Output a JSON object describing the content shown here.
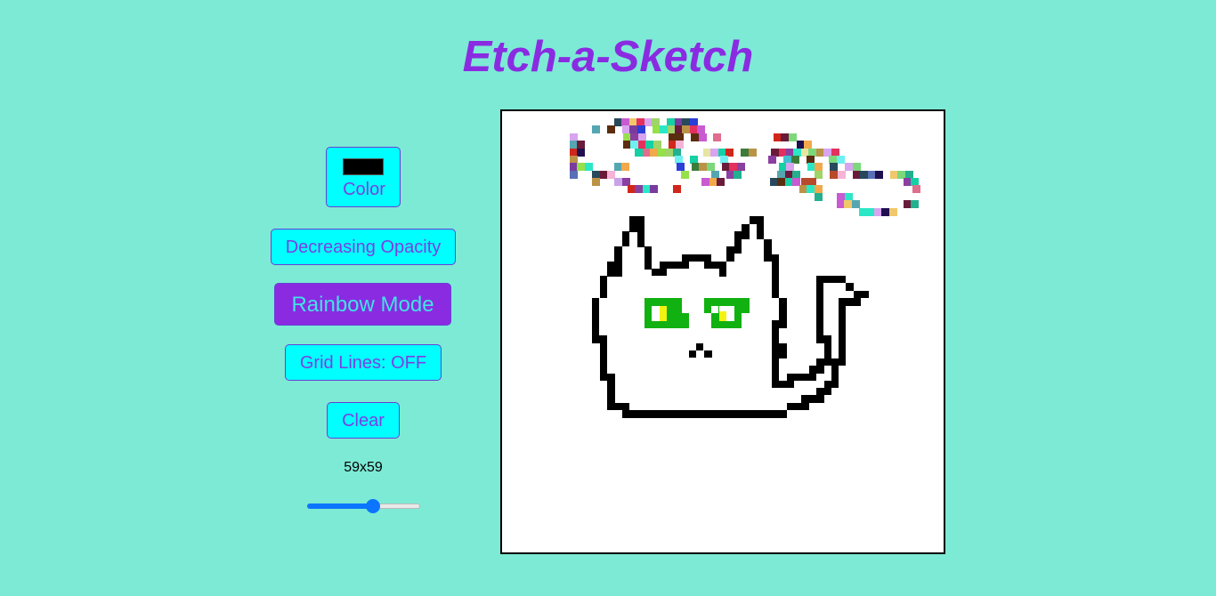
{
  "app": {
    "title": "Etch-a-Sketch"
  },
  "controls": {
    "color_label": "Color",
    "selected_color": "#000000",
    "opacity_label": "Decreasing Opacity",
    "rainbow_label": "Rainbow Mode",
    "grid_label": "Grid Lines: OFF",
    "clear_label": "Clear",
    "grid_size_label": "59x59",
    "grid_size_value": 59,
    "slider_min": 1,
    "slider_max": 100
  },
  "colors": {
    "background": "#7dead5",
    "accent": "#8a2be2",
    "button_bg": "#00ffff",
    "cat_eye_green": "#11b111",
    "cat_eye_yellow": "#f3f312"
  },
  "icons": {
    "color_swatch": "color-swatch-icon"
  }
}
